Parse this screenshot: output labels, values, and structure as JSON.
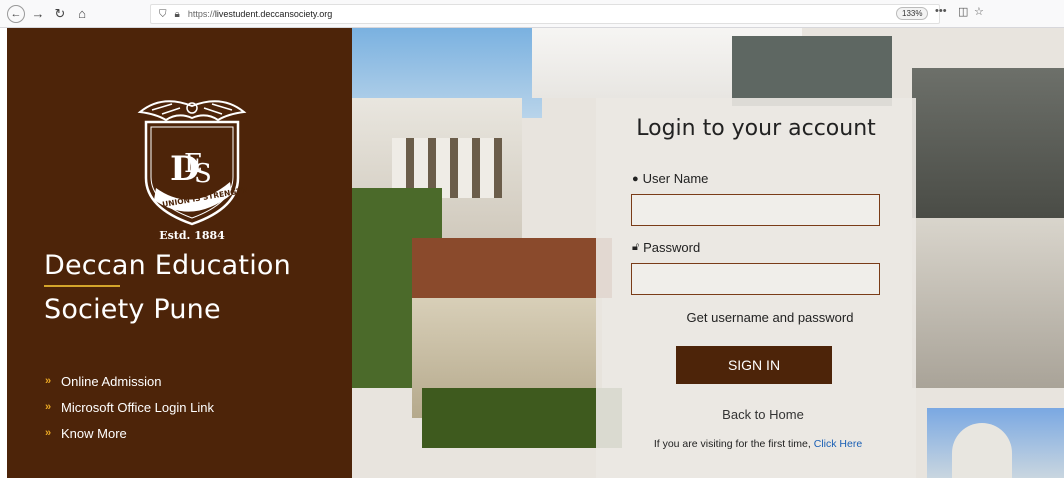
{
  "browser": {
    "url_prefix": "https://",
    "url_domain": "livestudent.deccansociety.org",
    "zoom": "133%",
    "more_label": "•••",
    "icons": [
      "back-arrow-icon",
      "forward-arrow-icon",
      "reload-icon",
      "home-icon",
      "shield-icon",
      "lock-icon",
      "pocket-icon",
      "bookmark-star-icon"
    ]
  },
  "crest": {
    "motto": "UNION IS STRENGTH",
    "monogram": "DES",
    "established": "Estd. 1884"
  },
  "org": {
    "title_line1": "Deccan Education",
    "title_line2": "Society Pune"
  },
  "links": [
    {
      "label": "Online Admission"
    },
    {
      "label": "Microsoft Office Login Link"
    },
    {
      "label": "Know More"
    }
  ],
  "login": {
    "title": "Login to your account",
    "username_label": "User Name",
    "username_value": "",
    "password_label": "Password",
    "password_value": "",
    "get_credentials": "Get username and password",
    "signin": "SIGN IN",
    "back_home": "Back to Home",
    "first_time_text": "If you are visiting for the first time,",
    "click_here": "Click Here"
  },
  "colors": {
    "brand_brown": "#4d2409",
    "accent_gold": "#d4a52b",
    "link_blue": "#1a5fb4"
  }
}
